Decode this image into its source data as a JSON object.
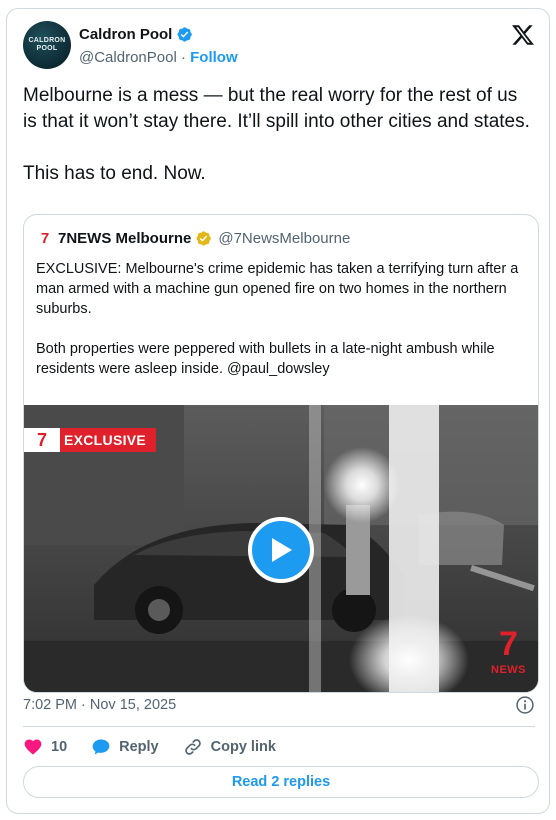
{
  "author": {
    "name": "Caldron Pool",
    "handle": "@CaldronPool",
    "separator": " · ",
    "follow_label": "Follow",
    "avatar_text_top": "CALDRON",
    "avatar_text_bottom": "POOL"
  },
  "tweet": {
    "text": "Melbourne is a mess — but the real worry for the rest of us is that it won’t stay there. It’ll spill into other cities and states.\n\nThis has to end. Now."
  },
  "quote": {
    "logo_glyph": "7",
    "name": "7NEWS Melbourne",
    "handle": "@7NewsMelbourne",
    "text": "EXCLUSIVE: Melbourne's crime epidemic has taken a terrifying turn after a man armed with a machine gun opened fire on two homes in the northern suburbs.\n\nBoth properties were peppered with bullets in a late-night ambush while residents were asleep inside. @paul_dowsley",
    "media": {
      "badge_logo": "7",
      "badge_label": "EXCLUSIVE",
      "watermark_big": "7",
      "watermark_small": "NEWS"
    }
  },
  "footer": {
    "timestamp": "7:02 PM · Nov 15, 2025",
    "like_count": "10",
    "reply_label": "Reply",
    "copy_link_label": "Copy link",
    "read_replies_label": "Read 2 replies"
  },
  "colors": {
    "accent": "#1d9bf0",
    "like": "#f91880",
    "brand_7news": "#e0212b",
    "text_primary": "#0f1419",
    "text_secondary": "#536471",
    "border": "#cfd9de"
  },
  "icons": {
    "verified": "verified-badge-icon",
    "gold_verified": "gold-verified-badge-icon",
    "x_logo": "x-logo-icon",
    "play": "play-icon",
    "info": "info-icon",
    "like": "heart-icon",
    "reply": "speech-bubble-icon",
    "copy_link": "link-icon"
  }
}
